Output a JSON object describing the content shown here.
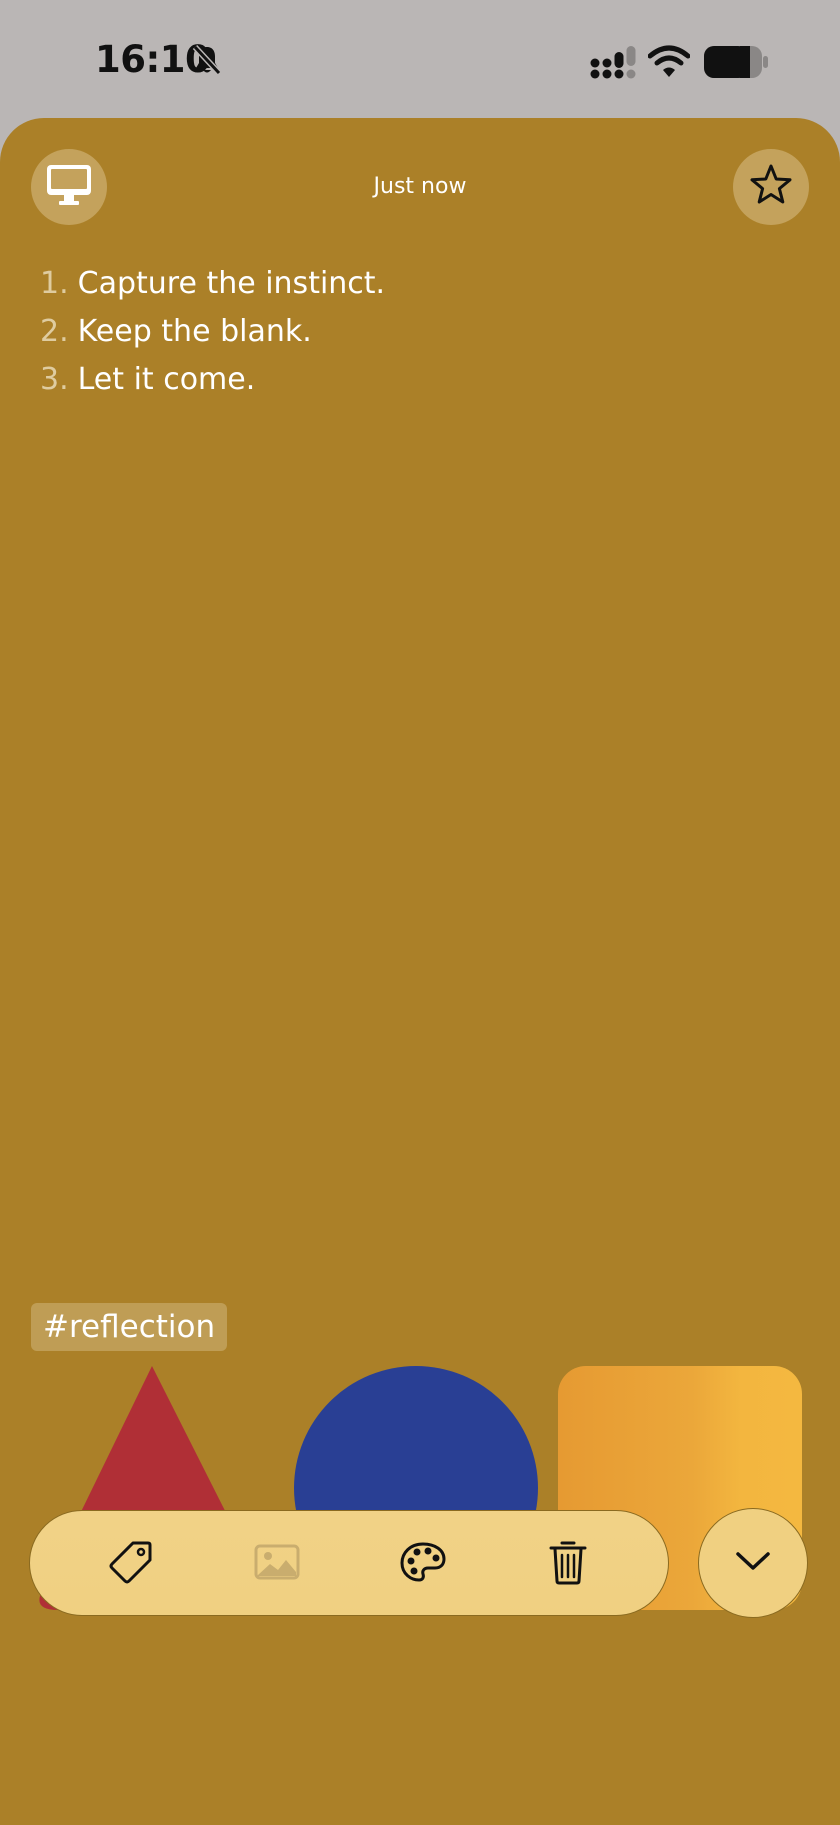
{
  "status_bar": {
    "time": "16:10",
    "icons": [
      "bell-slash-icon",
      "signal-icon",
      "wifi-icon",
      "battery-icon"
    ]
  },
  "note": {
    "timestamp": "Just now",
    "device_icon": "desktop-icon",
    "favorite_icon": "star-icon",
    "items": [
      {
        "number": "1.",
        "text": "Capture the instinct."
      },
      {
        "number": "2.",
        "text": "Keep the blank."
      },
      {
        "number": "3.",
        "text": "Let it come."
      }
    ],
    "tag": "#reflection"
  },
  "shapes": [
    {
      "name": "triangle",
      "color": "#b02f36"
    },
    {
      "name": "circle",
      "color": "#293f94"
    },
    {
      "name": "square",
      "color": "#f0ad3b"
    }
  ],
  "toolbar": {
    "items": [
      {
        "icon": "tag-icon",
        "enabled": true
      },
      {
        "icon": "image-icon",
        "enabled": false
      },
      {
        "icon": "palette-icon",
        "enabled": true
      },
      {
        "icon": "trash-icon",
        "enabled": true
      }
    ],
    "collapse_icon": "chevron-down-icon"
  },
  "colors": {
    "background": "#ab8028",
    "toolbar": "#f0d081",
    "text": "#ffffff"
  }
}
